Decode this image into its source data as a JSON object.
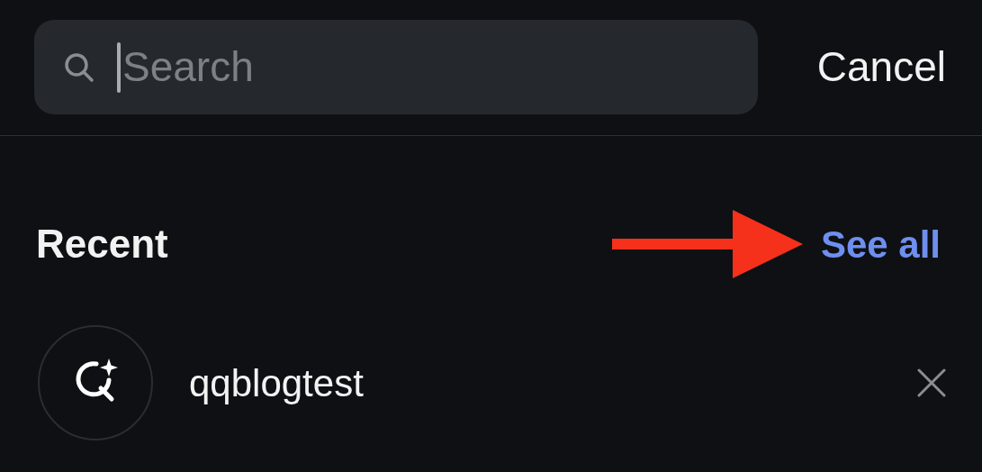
{
  "search": {
    "placeholder": "Search",
    "focused": true
  },
  "cancel": "Cancel",
  "recent": {
    "title": "Recent",
    "see_all": "See all"
  },
  "items": [
    {
      "text": "qqblogtest"
    }
  ]
}
